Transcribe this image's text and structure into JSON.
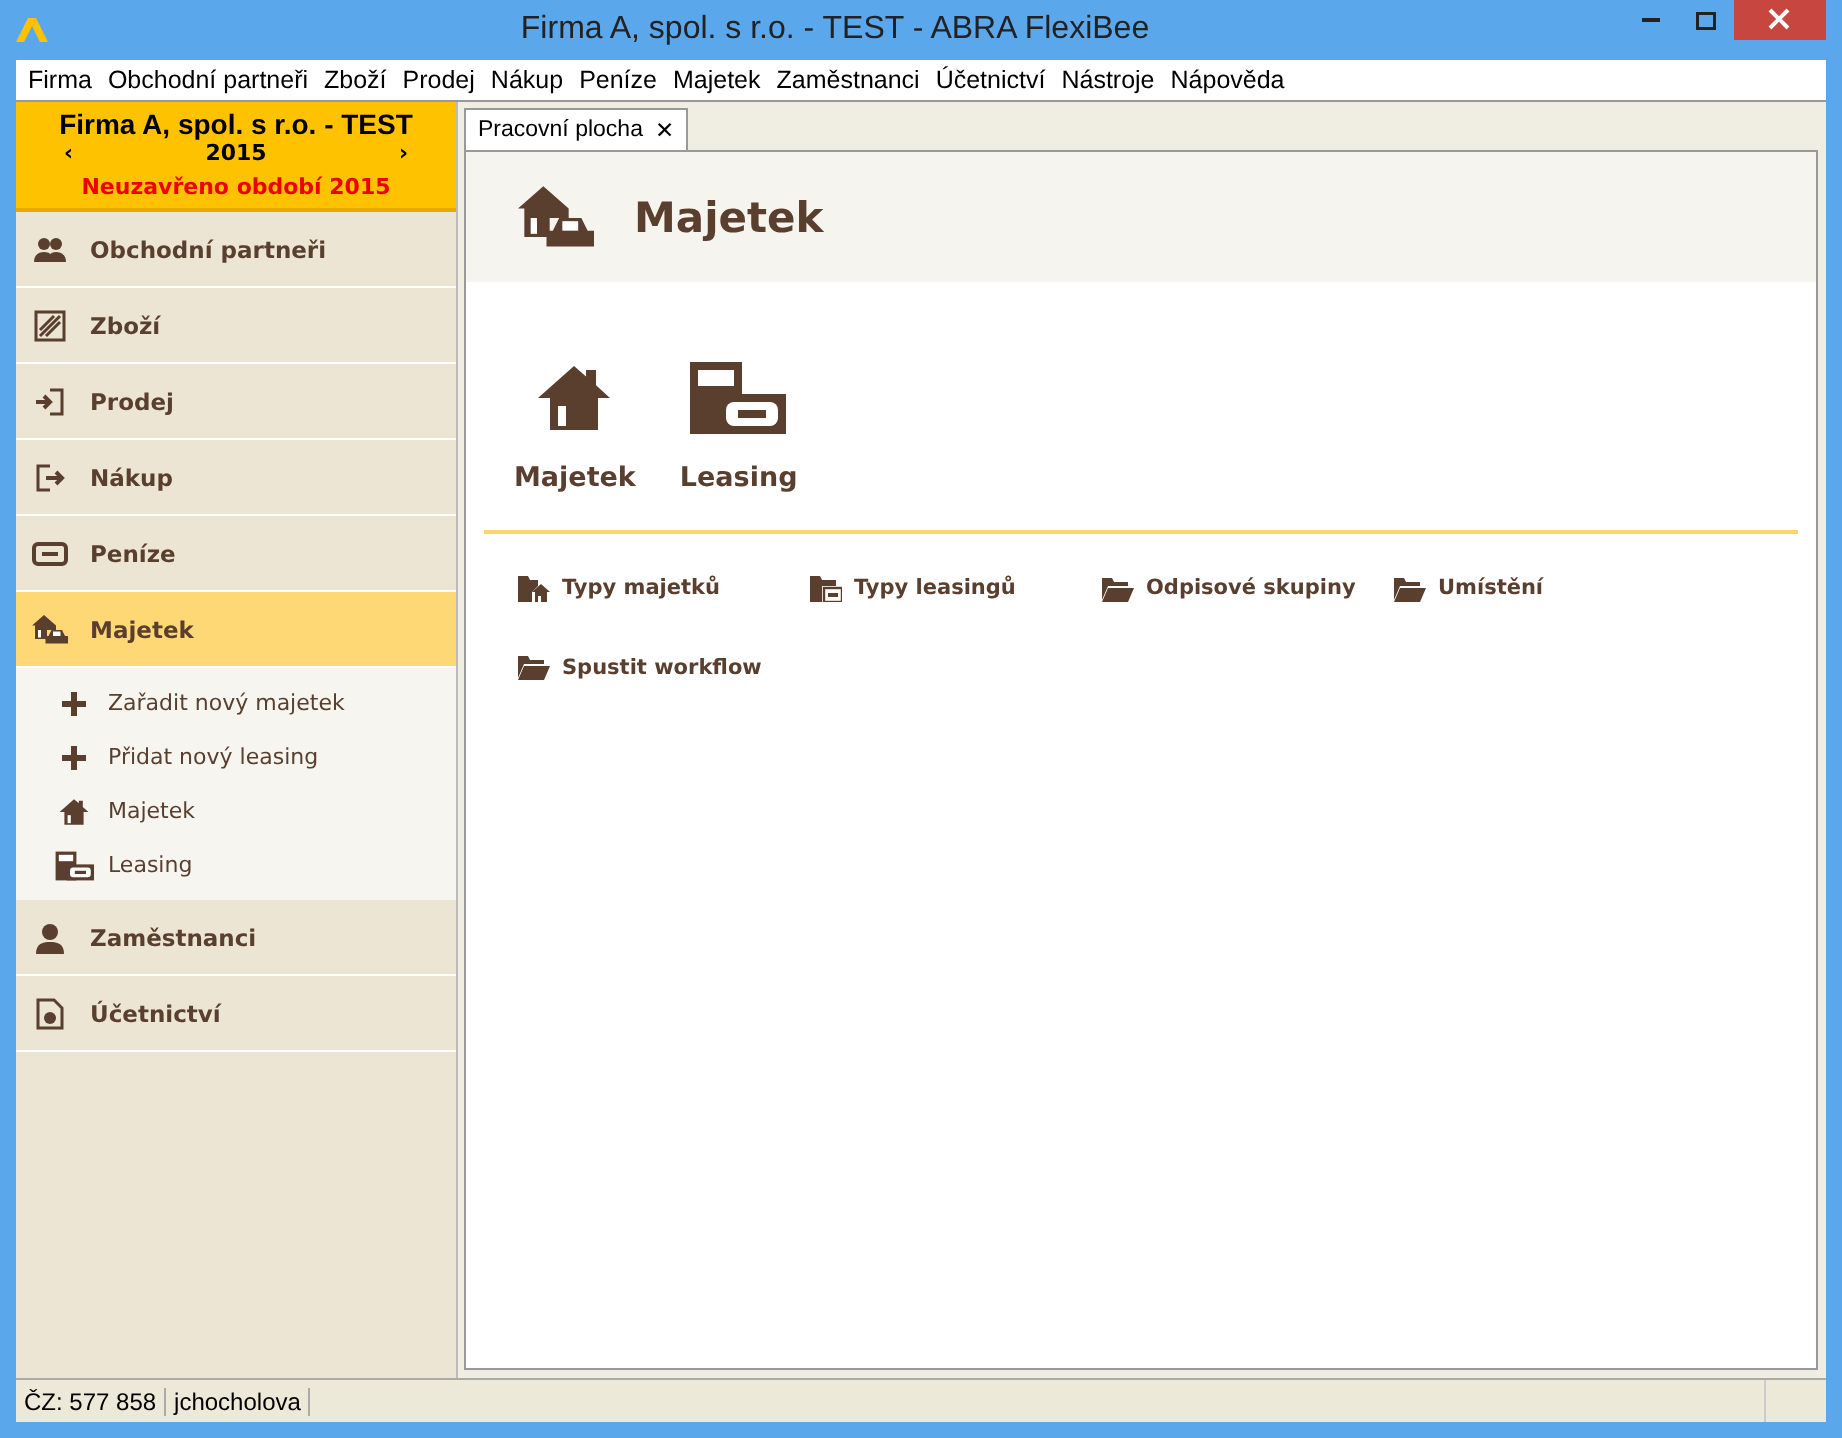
{
  "window": {
    "title": "Firma A, spol. s r.o. - TEST - ABRA FlexiBee"
  },
  "menu": [
    "Firma",
    "Obchodní partneři",
    "Zboží",
    "Prodej",
    "Nákup",
    "Peníze",
    "Majetek",
    "Zaměstnanci",
    "Účetnictví",
    "Nástroje",
    "Nápověda"
  ],
  "company": {
    "name": "Firma A, spol. s r.o. - TEST",
    "year": "2015",
    "prev": "‹",
    "next": "›",
    "warning": "Neuzavřeno období 2015"
  },
  "sidebar": {
    "items": [
      {
        "label": "Obchodní partneři",
        "selected": false
      },
      {
        "label": "Zboží",
        "selected": false
      },
      {
        "label": "Prodej",
        "selected": false
      },
      {
        "label": "Nákup",
        "selected": false
      },
      {
        "label": "Peníze",
        "selected": false
      },
      {
        "label": "Majetek",
        "selected": true,
        "children": [
          {
            "label": "Zařadit nový majetek",
            "kind": "add"
          },
          {
            "label": "Přidat nový leasing",
            "kind": "add"
          },
          {
            "label": "Majetek",
            "kind": "house"
          },
          {
            "label": "Leasing",
            "kind": "leasing"
          }
        ]
      },
      {
        "label": "Zaměstnanci",
        "selected": false
      },
      {
        "label": "Účetnictví",
        "selected": false
      }
    ]
  },
  "tabs": [
    {
      "label": "Pracovní plocha",
      "selected": true,
      "close": "✕"
    }
  ],
  "page": {
    "title": "Majetek",
    "tiles": [
      {
        "label": "Majetek",
        "kind": "house"
      },
      {
        "label": "Leasing",
        "kind": "leasing"
      }
    ],
    "links": [
      {
        "label": "Typy majetků",
        "kind": "house-folder"
      },
      {
        "label": "Typy leasingů",
        "kind": "leasing-folder"
      },
      {
        "label": "Odpisové skupiny",
        "kind": "folder"
      },
      {
        "label": "Umístění",
        "kind": "folder"
      },
      {
        "label": "Spustit workflow",
        "kind": "folder"
      }
    ]
  },
  "status_bar": [
    "ČZ: 577 858",
    "jchocholova"
  ]
}
